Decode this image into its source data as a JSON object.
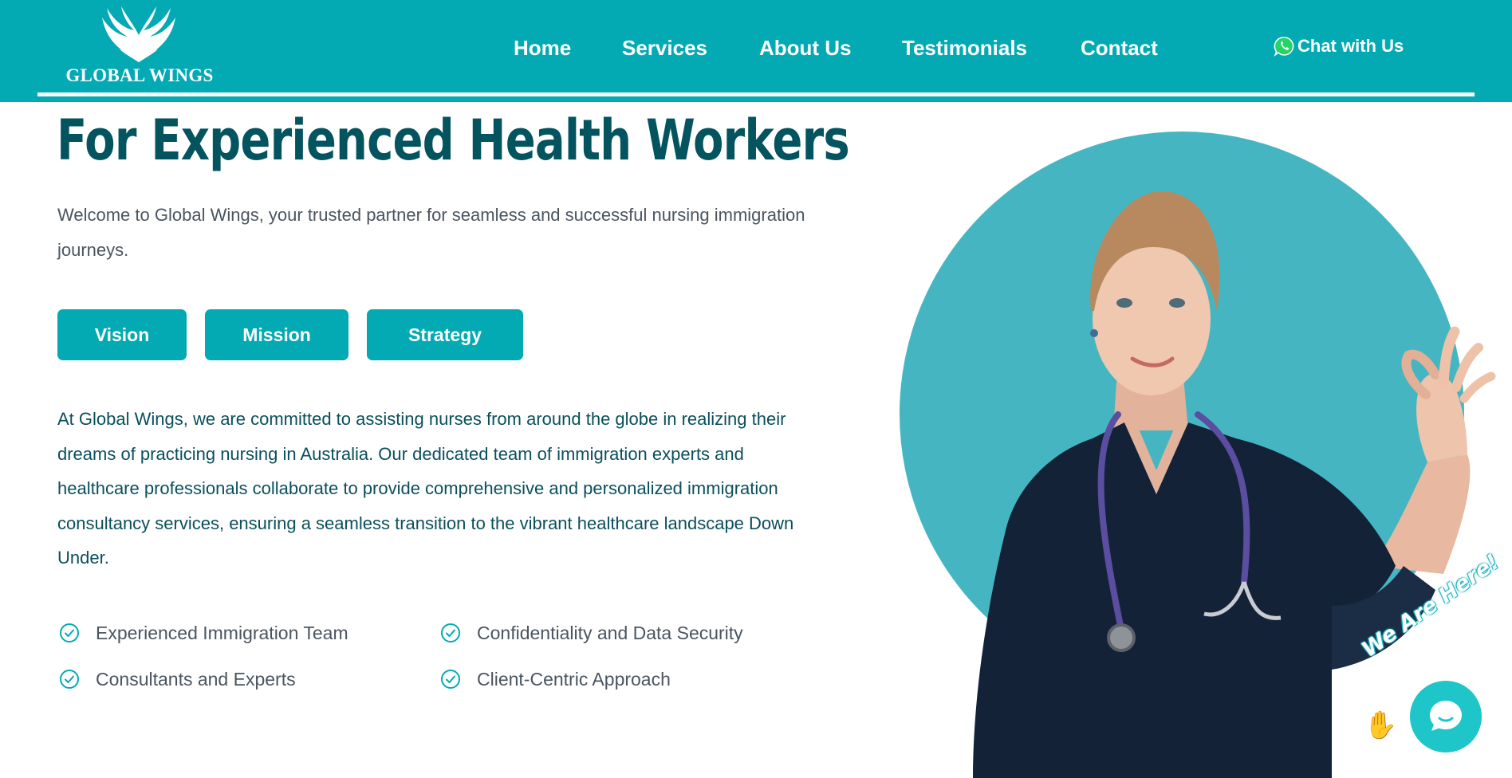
{
  "header": {
    "brand": "GLOBAL WINGS",
    "nav": [
      "Home",
      "Services",
      "About Us",
      "Testimonials",
      "Contact"
    ],
    "chat_label": "Chat with Us"
  },
  "hero": {
    "heading": "For Experienced Health Workers",
    "intro": "Welcome to Global Wings, your trusted partner for seamless and successful nursing immigration journeys.",
    "tabs": [
      "Vision",
      "Mission",
      "Strategy"
    ],
    "body": "At Global Wings, we are committed to assisting nurses from around the globe in realizing their dreams of practicing nursing in Australia. Our dedicated team of immigration experts and healthcare professionals collaborate to provide comprehensive and personalized immigration consultancy services, ensuring a seamless transition to the vibrant healthcare landscape Down Under.",
    "features": [
      "Experienced Immigration Team",
      "Confidentiality and Data Security",
      "Consultants and Experts",
      "Client-Centric Approach"
    ]
  },
  "chat_widget": {
    "tagline": "We Are Here!",
    "icon": "chat-bubble-icon"
  },
  "colors": {
    "brand": "#03AAB4",
    "heading": "#03545F",
    "circle": "#46B5C2",
    "scrubs": "#142238"
  },
  "icons": [
    "wings-logo-icon",
    "whatsapp-icon",
    "check-circle-icon",
    "wave-hand-icon",
    "chat-bubble-icon"
  ]
}
